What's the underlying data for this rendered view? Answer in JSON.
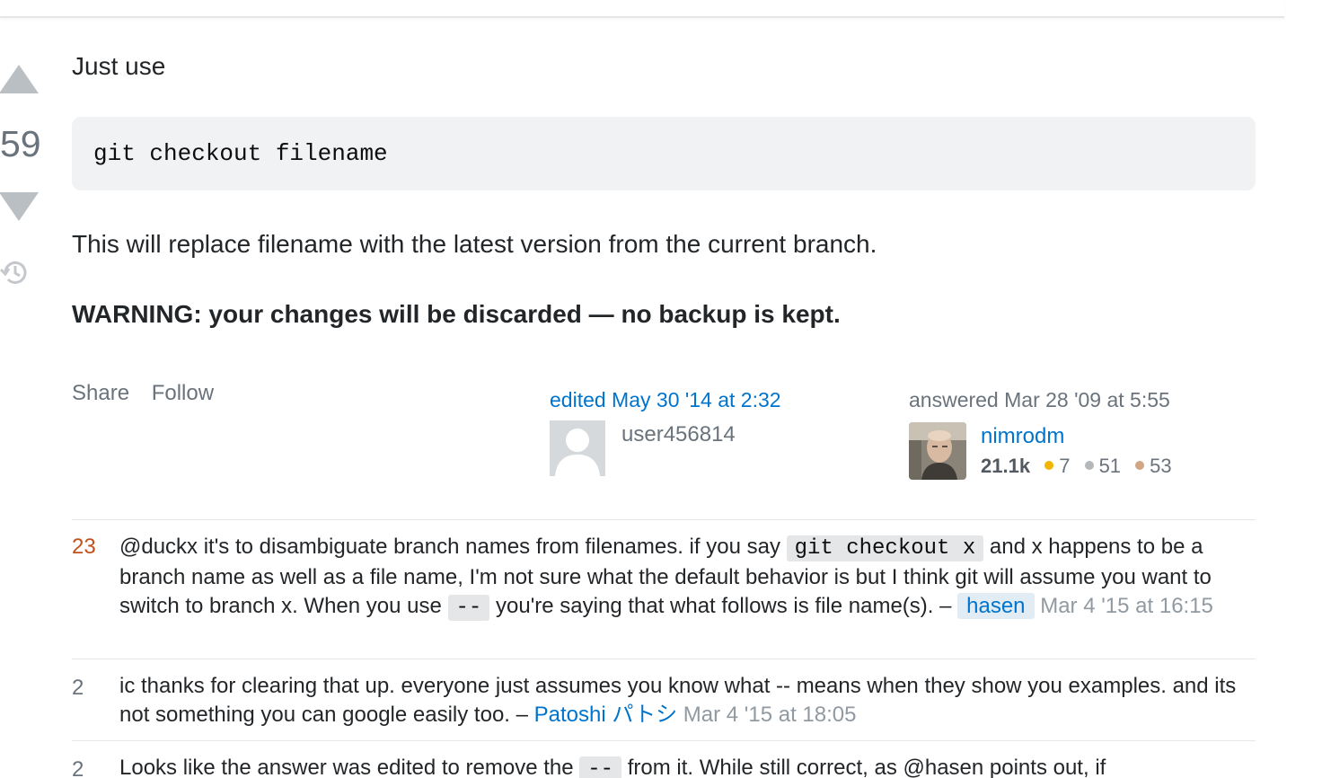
{
  "vote": {
    "count": "59"
  },
  "post": {
    "intro": "Just use",
    "code": "git checkout filename",
    "explanation": "This will replace filename with the latest version from the current branch.",
    "warning": "WARNING: your changes will be discarded — no backup is kept."
  },
  "menu": {
    "share_label": "Share",
    "follow_label": "Follow"
  },
  "edited": {
    "action": "edited May 30 '14 at 2:32",
    "username": "user456814"
  },
  "owner": {
    "action": "answered Mar 28 '09 at 5:55",
    "username": "nimrodm",
    "reputation": "21.1k",
    "gold": "7",
    "silver": "51",
    "bronze": "53"
  },
  "colors": {
    "gold": "#f1b600",
    "silver": "#b4b8bc",
    "bronze": "#d1a684",
    "link": "#0074cc",
    "hot_score": "#c4501a"
  },
  "comments": [
    {
      "score": "23",
      "text_1": "@duckx it's to disambiguate branch names from filenames. if you say",
      "code_1": "git checkout x",
      "text_2": "and x happens to be a branch name as well as a file name, I'm not sure what the default behavior is but I think git will assume you want to switch to branch x. When you use",
      "code_2": "--",
      "text_3": "you're saying that what follows is file name(s). –",
      "user": "hasen",
      "date": "Mar 4 '15 at 16:15"
    },
    {
      "score": "2",
      "text_1": "ic thanks for clearing that up. everyone just assumes you know what -- means when they show you examples. and its not something you can google easily too. –",
      "user": "Patoshi パトシ",
      "date": "Mar 4 '15 at 18:05"
    },
    {
      "score": "2",
      "text_1": "Looks like the answer was edited to remove the",
      "code_1": "--",
      "text_2": "from it. While still correct, as @hasen points out, if"
    }
  ]
}
